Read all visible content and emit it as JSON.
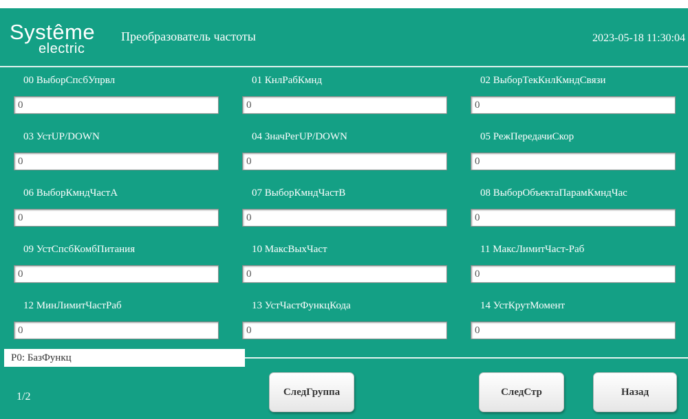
{
  "header": {
    "logo_main": "Systême",
    "logo_sub": "electric",
    "title": "Преобразователь частоты",
    "datetime": "2023-05-18 11:30:04"
  },
  "params": [
    {
      "label": "00 ВыборСпсбУпрвл",
      "value": "0"
    },
    {
      "label": "01 КнлРабКмнд",
      "value": "0"
    },
    {
      "label": "02 ВыборТекКнлКмндСвязи",
      "value": "0"
    },
    {
      "label": "03 УстUP/DOWN",
      "value": "0"
    },
    {
      "label": "04 ЗначРегUP/DOWN",
      "value": "0"
    },
    {
      "label": "05 РежПередачиСкор",
      "value": "0"
    },
    {
      "label": "06 ВыборКмндЧастА",
      "value": "0"
    },
    {
      "label": "07 ВыборКмндЧастВ",
      "value": "0"
    },
    {
      "label": "08 ВыборОбъектаПарамКмндЧас",
      "value": "0"
    },
    {
      "label": "09 УстСпсбКомбПитания",
      "value": "0"
    },
    {
      "label": "10 МаксВыхЧаст",
      "value": "0"
    },
    {
      "label": "11 МаксЛимитЧаст-Раб",
      "value": "0"
    },
    {
      "label": "12 МинЛимитЧастРаб",
      "value": "0"
    },
    {
      "label": "13 УстЧастФункцКода",
      "value": "0"
    },
    {
      "label": "14 УстКрутМомент",
      "value": "0"
    }
  ],
  "group_tab": "P0: БазФункц",
  "footer": {
    "page_indicator": "1/2",
    "next_group_label": "СледГруппа",
    "next_page_label": "СледСтр",
    "back_label": "Назад"
  },
  "colors": {
    "background": "#14a085",
    "text_light": "#ffffff"
  }
}
